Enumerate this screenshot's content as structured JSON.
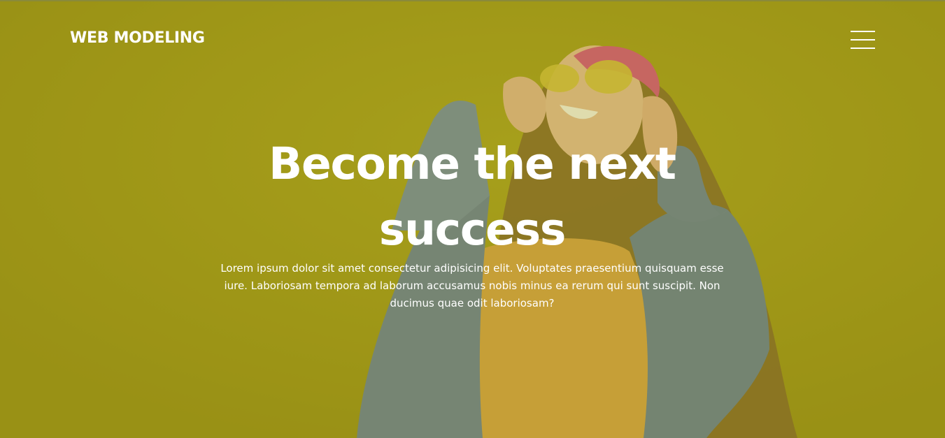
{
  "header": {
    "brand": "WEB MODELING",
    "menu_icon": "hamburger-menu-icon"
  },
  "hero": {
    "headline": "Become the next success",
    "body": "Lorem ipsum dolor sit amet consectetur adipisicing elit. Voluptates praesentium quisquam esse iure. Laboriosam tempora ad laborum accusamus nobis minus ea rerum qui sunt suscipit. Non ducimus quae odit laboriosam?"
  },
  "colors": {
    "background_overlay": "#9c9418",
    "text": "#ffffff"
  }
}
